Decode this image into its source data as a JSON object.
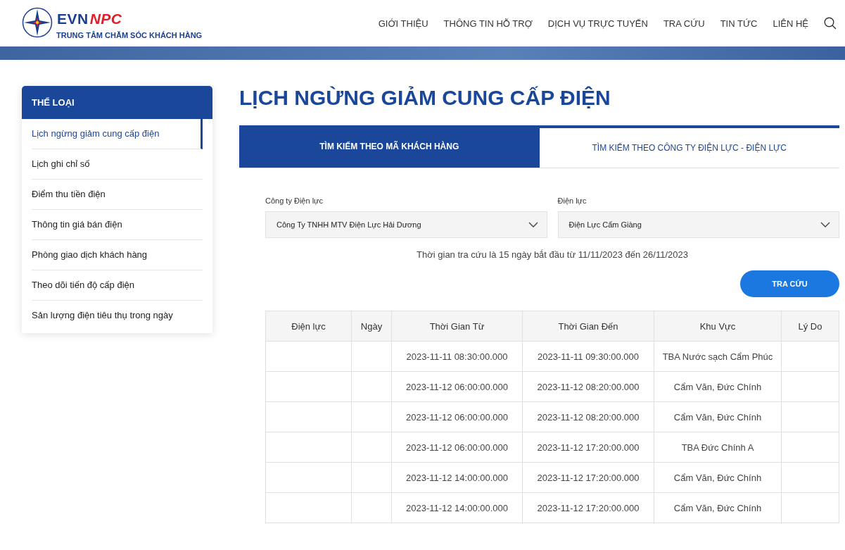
{
  "header": {
    "logo": {
      "brand_part1": "EVN",
      "brand_part2": "NPC",
      "subtitle": "TRUNG TÂM CHĂM SÓC KHÁCH HÀNG"
    },
    "nav": [
      "GIỚI THIỆU",
      "THÔNG TIN HỖ TRỢ",
      "DỊCH VỤ TRỰC TUYẾN",
      "TRA CỨU",
      "TIN TỨC",
      "LIÊN HỆ"
    ]
  },
  "sidebar": {
    "title": "THỂ LOẠI",
    "items": [
      {
        "label": "Lịch ngừng giảm cung cấp điện",
        "selected": true
      },
      {
        "label": "Lịch ghi chỉ số",
        "selected": false
      },
      {
        "label": "Điểm thu tiền điện",
        "selected": false
      },
      {
        "label": "Thông tin giá bán điện",
        "selected": false
      },
      {
        "label": "Phòng giao dịch khách hàng",
        "selected": false
      },
      {
        "label": "Theo dõi tiến độ cấp điện",
        "selected": false
      },
      {
        "label": "Sản lượng điện tiêu thụ trong ngày",
        "selected": false
      }
    ]
  },
  "page_title": "LỊCH NGỪNG GIẢM CUNG CẤP ĐIỆN",
  "tabs": [
    {
      "label": "TÌM KIẾM THEO MÃ KHÁCH HÀNG",
      "selected": false
    },
    {
      "label": "TÌM KIẾM THEO CÔNG TY ĐIỆN LỰC - ĐIỆN LỰC",
      "selected": true
    }
  ],
  "form": {
    "fields": [
      {
        "label": "Công ty Điện lực",
        "value": "Công Ty TNHH MTV Điện Lực Hải Dương"
      },
      {
        "label": "Điện lực",
        "value": "Điện Lực Cẩm Giàng"
      }
    ],
    "note": "Thời gian tra cứu là 15 ngày bắt đầu từ 11/11/2023 đến 26/11/2023",
    "button": "TRA CỨU"
  },
  "table": {
    "columns": [
      "Điện lực",
      "Ngày",
      "Thời Gian Từ",
      "Thời Gian Đến",
      "Khu Vực",
      "Lý Do"
    ],
    "rows": [
      [
        "",
        "",
        "2023-11-11 08:30:00.000",
        "2023-11-11 09:30:00.000",
        "TBA Nước sạch Cẩm Phúc",
        ""
      ],
      [
        "",
        "",
        "2023-11-12 06:00:00.000",
        "2023-11-12 08:20:00.000",
        "Cẩm Văn, Đức Chính",
        ""
      ],
      [
        "",
        "",
        "2023-11-12 06:00:00.000",
        "2023-11-12 08:20:00.000",
        "Cẩm Văn, Đức Chính",
        ""
      ],
      [
        "",
        "",
        "2023-11-12 06:00:00.000",
        "2023-11-12 17:20:00.000",
        "TBA Đức Chính A",
        ""
      ],
      [
        "",
        "",
        "2023-11-12 14:00:00.000",
        "2023-11-12 17:20:00.000",
        "Cẩm Văn, Đức Chính",
        ""
      ],
      [
        "",
        "",
        "2023-11-12 14:00:00.000",
        "2023-11-12 17:20:00.000",
        "Cẩm Văn, Đức Chính",
        ""
      ]
    ]
  }
}
